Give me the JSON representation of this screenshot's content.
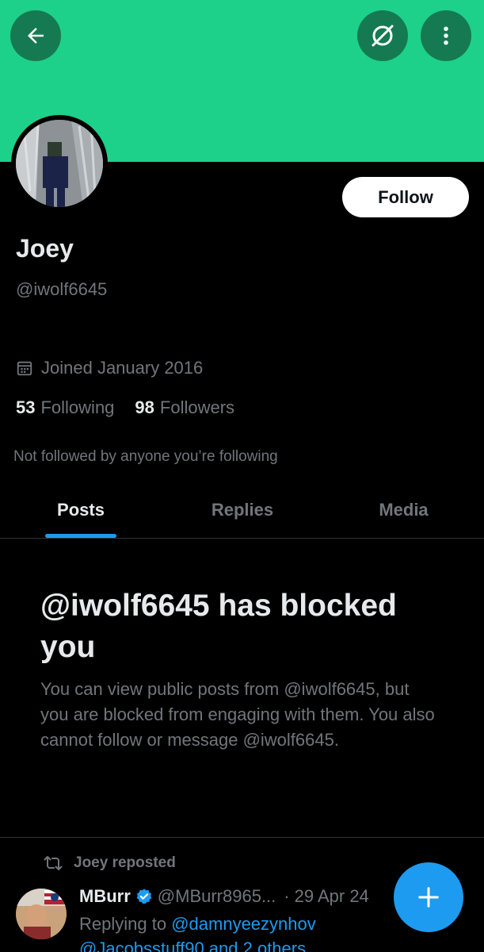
{
  "header": {
    "back_icon": "arrow-left-icon",
    "grok_icon": "grok-icon",
    "more_icon": "more-vertical-icon",
    "banner_color": "#1dd18b"
  },
  "profile": {
    "follow_label": "Follow",
    "name": "Joey",
    "handle": "@iwolf6645",
    "joined": "Joined January 2016",
    "following_count": "53",
    "following_label": "Following",
    "followers_count": "98",
    "followers_label": "Followers",
    "not_followed_text": "Not followed by anyone you’re following"
  },
  "tabs": [
    {
      "label": "Posts",
      "active": true
    },
    {
      "label": "Replies",
      "active": false
    },
    {
      "label": "Media",
      "active": false
    }
  ],
  "blocked": {
    "title": "@iwolf6645 has blocked you",
    "description": "You can view public posts from @iwolf6645, but you are blocked from engaging with them. You also cannot follow or message @iwolf6645."
  },
  "post": {
    "repost_label": "Joey reposted",
    "author_name": "MBurr",
    "author_handle": "@MBurr8965...",
    "separator": "·",
    "date": "29 Apr 24",
    "replying_prefix": "Replying to",
    "replying_user": "@damnyeezynhov",
    "replying_more": "@Jacobsstuff90 and 2 others"
  },
  "fab": {
    "icon": "plus-icon"
  },
  "colors": {
    "accent": "#1d9bf0",
    "muted_text": "#71767b",
    "primary_text": "#e7e9ea",
    "background": "#000000"
  }
}
